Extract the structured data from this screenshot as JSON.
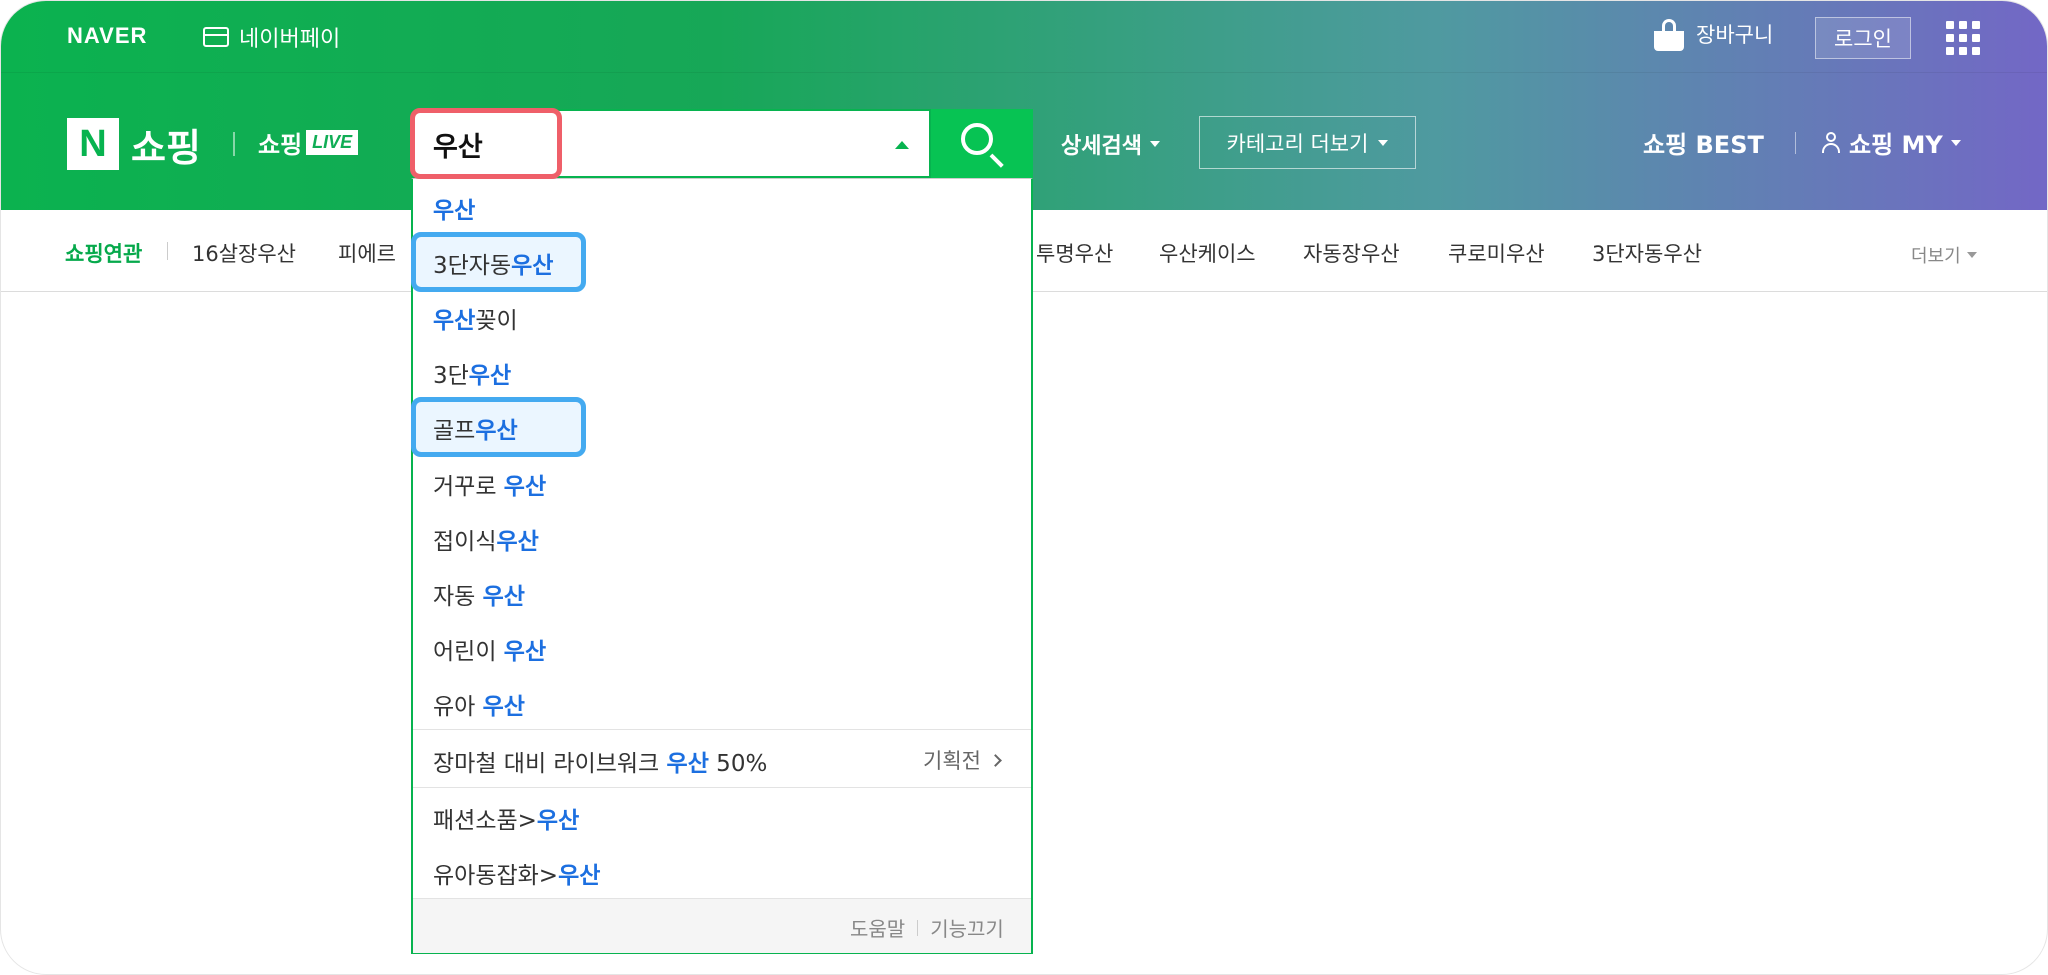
{
  "topbar": {
    "naver": "NAVER",
    "pay": "네이버페이",
    "cart": "장바구니",
    "login": "로그인"
  },
  "header": {
    "logo_n": "N",
    "logo_text": "쇼핑",
    "live_prefix": "쇼핑",
    "live_tag": "LIVE",
    "search_value": "우산",
    "detail_search": "상세검색",
    "category_more": "카테고리 더보기",
    "best": "쇼핑 BEST",
    "my": "쇼핑 MY"
  },
  "related": {
    "title": "쇼핑연관",
    "items": [
      "16살장우산",
      "피에르",
      "투명우산",
      "우산케이스",
      "자동장우산",
      "쿠로미우산",
      "3단자동우산"
    ],
    "more": "더보기"
  },
  "suggestions": [
    {
      "pre": "",
      "hl": "우산",
      "post": ""
    },
    {
      "pre": "3단자동",
      "hl": "우산",
      "post": ""
    },
    {
      "pre": "",
      "hl": "우산",
      "post": "꽂이"
    },
    {
      "pre": "3단",
      "hl": "우산",
      "post": ""
    },
    {
      "pre": "골프",
      "hl": "우산",
      "post": ""
    },
    {
      "pre": "거꾸로 ",
      "hl": "우산",
      "post": ""
    },
    {
      "pre": "접이식",
      "hl": "우산",
      "post": ""
    },
    {
      "pre": "자동 ",
      "hl": "우산",
      "post": ""
    },
    {
      "pre": "어린이 ",
      "hl": "우산",
      "post": ""
    },
    {
      "pre": "유아 ",
      "hl": "우산",
      "post": ""
    }
  ],
  "promo": {
    "pre": "장마철 대비 라이브워크 ",
    "hl": "우산",
    "post": " 50%",
    "tag": "기획전"
  },
  "categories": [
    {
      "pre": "패션소품>",
      "hl": "우산"
    },
    {
      "pre": "유아동잡화>",
      "hl": "우산"
    }
  ],
  "footer": {
    "help": "도움말",
    "off": "기능끄기"
  },
  "colors": {
    "brand_green": "#07b34f",
    "highlight_blue": "#1c6fe0",
    "outline_red": "#ef5f69",
    "outline_blue": "#44aaf0"
  }
}
